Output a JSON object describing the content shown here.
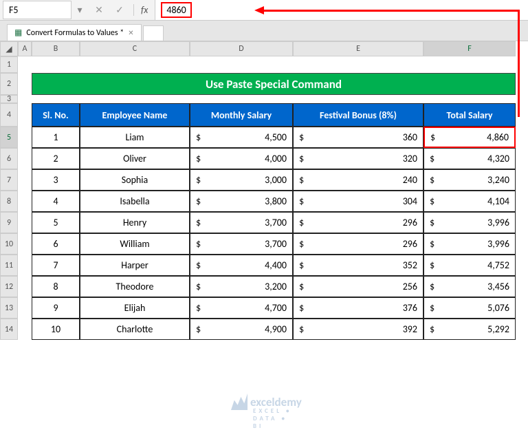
{
  "nameBox": "F5",
  "formulaValue": "4860",
  "tab": {
    "label": "Convert Formulas to Values *"
  },
  "columns": [
    "A",
    "B",
    "C",
    "D",
    "E",
    "F"
  ],
  "selectedCol": "F",
  "rowNumbers": [
    "1",
    "2",
    "3",
    "4",
    "5",
    "6",
    "7",
    "8",
    "9",
    "10",
    "11",
    "12",
    "13",
    "14"
  ],
  "selectedRow": "5",
  "title": "Use Paste Special Command",
  "headers": {
    "sl": "Sl. No.",
    "name": "Employee Name",
    "monthly": "Monthly Salary",
    "bonus": "Festival Bonus (8%)",
    "total": "Total Salary"
  },
  "currency": "$",
  "rows": [
    {
      "sl": "1",
      "name": "Liam",
      "monthly": "4,500",
      "bonus": "360",
      "total": "4,860"
    },
    {
      "sl": "2",
      "name": "Oliver",
      "monthly": "4,000",
      "bonus": "320",
      "total": "4,320"
    },
    {
      "sl": "3",
      "name": "Sophia",
      "monthly": "3,000",
      "bonus": "240",
      "total": "3,240"
    },
    {
      "sl": "4",
      "name": "Isabella",
      "monthly": "3,800",
      "bonus": "304",
      "total": "4,104"
    },
    {
      "sl": "5",
      "name": "Henry",
      "monthly": "3,700",
      "bonus": "296",
      "total": "3,996"
    },
    {
      "sl": "6",
      "name": "William",
      "monthly": "3,700",
      "bonus": "296",
      "total": "3,996"
    },
    {
      "sl": "7",
      "name": "Harper",
      "monthly": "4,400",
      "bonus": "352",
      "total": "4,752"
    },
    {
      "sl": "8",
      "name": "Theodore",
      "monthly": "3,200",
      "bonus": "256",
      "total": "3,456"
    },
    {
      "sl": "9",
      "name": "Elijah",
      "monthly": "4,700",
      "bonus": "376",
      "total": "5,076"
    },
    {
      "sl": "10",
      "name": "Charlotte",
      "monthly": "4,900",
      "bonus": "392",
      "total": "5,292"
    }
  ],
  "watermark": {
    "brand": "exceldemy",
    "tagline": "EXCEL • DATA • BI"
  }
}
